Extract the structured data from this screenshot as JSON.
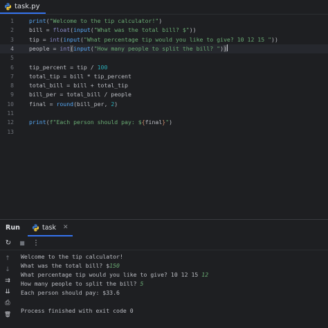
{
  "tab": {
    "filename": "task.py"
  },
  "editor": {
    "current_line": 4,
    "lines": [
      {
        "n": "1"
      },
      {
        "n": "2"
      },
      {
        "n": "3"
      },
      {
        "n": "4"
      },
      {
        "n": "5"
      },
      {
        "n": "6"
      },
      {
        "n": "7"
      },
      {
        "n": "8"
      },
      {
        "n": "9"
      },
      {
        "n": "10"
      },
      {
        "n": "11"
      },
      {
        "n": "12"
      },
      {
        "n": "13"
      }
    ],
    "code": {
      "l1": {
        "a": "print",
        "b": "(",
        "c": "\"Welcome to the tip calculator!\"",
        "d": ")"
      },
      "l2": {
        "a": "bill = ",
        "b": "float",
        "c": "(",
        "d": "input",
        "e": "(",
        "f": "\"What was the total bill? $\"",
        "g": "))"
      },
      "l3": {
        "a": "tip = ",
        "b": "int",
        "c": "(",
        "d": "input",
        "e": "(",
        "f": "\"What percentage tip would you like to give? 10 12 15 \"",
        "g": "))"
      },
      "l4": {
        "a": "people = ",
        "b": "int",
        "c": "(",
        "d": "input",
        "e": "(",
        "f": "\"How many people to split the bill? \"",
        "g": ")",
        "h": ")"
      },
      "l6": {
        "a": "tip_percent = tip / ",
        "b": "100"
      },
      "l7": {
        "a": "total_tip = bill * tip_percent"
      },
      "l8": {
        "a": "total_bill = bill + total_tip"
      },
      "l9": {
        "a": "bill_per = total_bill / people"
      },
      "l10": {
        "a": "final = ",
        "b": "round",
        "c": "(bill_per, ",
        "d": "2",
        "e": ")"
      },
      "l12": {
        "a": "print",
        "b": "(",
        "c": "f\"Each person should pay: $",
        "d": "{",
        "e": "final",
        "f": "}",
        "g": "\"",
        "h": ")"
      }
    }
  },
  "run_panel": {
    "title": "Run",
    "tab_label": "task",
    "close_glyph": "✕",
    "toolbar": {
      "rerun_glyph": "↻",
      "stop_glyph": "■",
      "more_glyph": "⋮"
    },
    "side_tools": {
      "up": "↑",
      "down": "↓",
      "wrap": "⇉",
      "scroll_end": "⇊",
      "print": "⎙",
      "trash": "🗑"
    },
    "console": {
      "l1": "Welcome to the tip calculator!",
      "l2_prompt": "What was the total bill? $",
      "l2_input": "150",
      "l3_prompt": "What percentage tip would you like to give? 10 12 15 ",
      "l3_input": "12",
      "l4_prompt": "How many people to split the bill? ",
      "l4_input": "5",
      "l5": "Each person should pay: $33.6",
      "l7": "Process finished with exit code 0"
    }
  },
  "colors": {
    "background": "#1e1f22",
    "function": "#56a8f5",
    "string": "#6aab73",
    "number": "#2aacb8",
    "accent": "#3574f0"
  }
}
